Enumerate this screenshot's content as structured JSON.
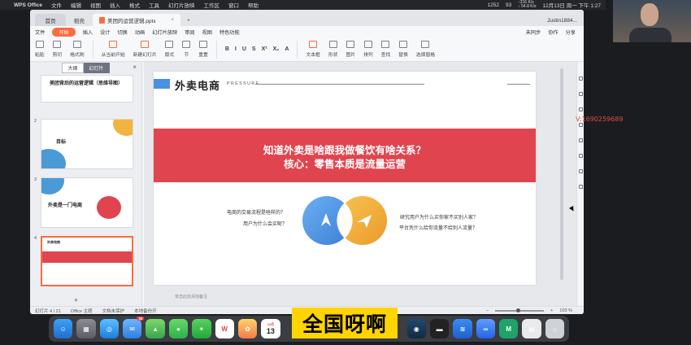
{
  "menubar": {
    "app_name": "WPS Office",
    "items": [
      "文件",
      "编辑",
      "视图",
      "插入",
      "格式",
      "工具",
      "幻灯片放映",
      "工作区",
      "窗口",
      "帮助"
    ],
    "status_count": "1252",
    "wechat_count": "93",
    "net_up": "↑216 K/s",
    "net_down": "↓ 54.8 K/s",
    "datetime": "12月13日 周一 下午 1:27"
  },
  "tabs": {
    "home": "首页",
    "second": "稻壳",
    "doc": "美团的运营逻辑.pptx",
    "user": "Justin1884..."
  },
  "menu": {
    "file": "文件",
    "items": [
      "开始",
      "插入",
      "设计",
      "切换",
      "动画",
      "幻灯片放映",
      "审阅",
      "视图",
      "特色功能"
    ],
    "right": [
      "未同步",
      "协作",
      "分享"
    ]
  },
  "ribbon": {
    "paste": "粘贴",
    "cut": "剪切",
    "copy": "复制",
    "format_brush": "格式刷",
    "play_from_current": "从当前开始",
    "new_slide": "新建幻灯片",
    "layout": "版式",
    "section": "节",
    "reset": "重置",
    "text_box": "文本框",
    "shape": "形状",
    "arrange": "排列",
    "find": "查找",
    "replace": "替换",
    "select_pane": "选择窗格",
    "picture": "图片",
    "fill": "填充",
    "outline": "轮廓",
    "format_letters": [
      "B",
      "I",
      "U",
      "S",
      "X²",
      "X₂",
      "A"
    ]
  },
  "leftpanel": {
    "tab_outline": "大纲",
    "tab_slides": "幻灯片",
    "slide1_title": "美团背后的运营逻辑（思维导图）",
    "slide2_title": "目标",
    "slide3_title": "外卖是一门电商",
    "slide4_title": "外卖电商",
    "numbers": [
      "2",
      "3",
      "4"
    ]
  },
  "slide": {
    "title": "外卖电商",
    "subtitle": "PRESSURE",
    "question": "知道外卖是啥跟我做餐饮有啥关系？",
    "core": "核心：零售本质是流量运营",
    "left_q1": "电商的交易流程是啥样的？",
    "left_q2": "用户为什么会买呢？",
    "right_q1": "研究用户为什么买你家不买别人家？",
    "right_q2": "平台凭什么给你流量不给别人流量？",
    "colors": {
      "band": "#e0454f",
      "blue": "#4a90e2",
      "orange": "#f0a030"
    }
  },
  "notes_placeholder": "单击此处添加备注",
  "status": {
    "slide_count": "幻灯片 4 / 21",
    "theme": "Office 主题",
    "doc_protect": "文档未保护",
    "backup": "本地备份开",
    "zoom": "103 %"
  },
  "dock": {
    "mail_badge": "30",
    "calendar_month": "12月",
    "calendar_day": "13",
    "wps_label": "W"
  },
  "caption": "全国呀啊",
  "watermark": "V:1690259689"
}
